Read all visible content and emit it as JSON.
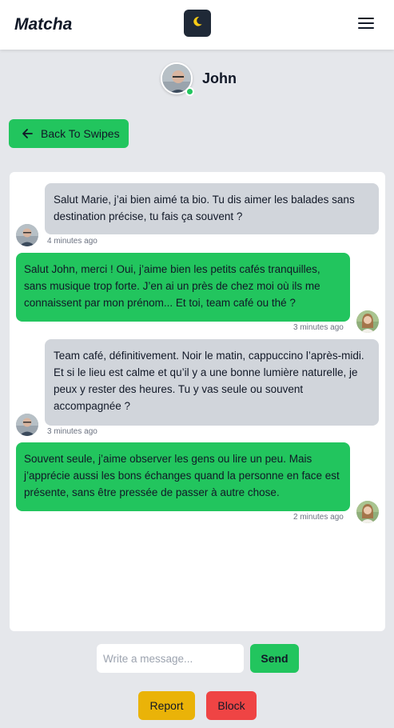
{
  "header": {
    "brand": "Matcha",
    "theme_icon": "moon-icon",
    "menu_icon": "hamburger-menu-icon"
  },
  "profile": {
    "name": "John",
    "status": "online"
  },
  "back_button": {
    "label": "Back To Swipes"
  },
  "messages": [
    {
      "sender": "them",
      "text": "Salut Marie, j’ai bien aimé ta bio. Tu dis aimer les balades sans destination précise, tu fais ça souvent ?",
      "time": "4 minutes ago"
    },
    {
      "sender": "me",
      "text": "Salut John, merci ! Oui, j’aime bien les petits cafés tranquilles, sans musique trop forte. J’en ai un près de chez moi où ils me connaissent par mon prénom... Et toi, team café ou thé ?",
      "time": "3 minutes ago"
    },
    {
      "sender": "them",
      "text": "Team café, définitivement. Noir le matin, cappuccino l’après-midi. Et si le lieu est calme et qu’il y a une bonne lumière naturelle, je peux y rester des heures. Tu y vas seule ou souvent accompagnée ?",
      "time": "3 minutes ago"
    },
    {
      "sender": "me",
      "text": "Souvent seule, j’aime observer les gens ou lire un peu. Mais j’apprécie aussi les bons échanges quand la personne en face est présente, sans être pressée de passer à autre chose.",
      "time": "2 minutes ago"
    }
  ],
  "composer": {
    "placeholder": "Write a message...",
    "value": "",
    "send_label": "Send"
  },
  "actions": {
    "report_label": "Report",
    "block_label": "Block"
  },
  "colors": {
    "accent": "#22c55e",
    "report": "#eab308",
    "block": "#ef4444",
    "header_dark": "#1f2937"
  }
}
